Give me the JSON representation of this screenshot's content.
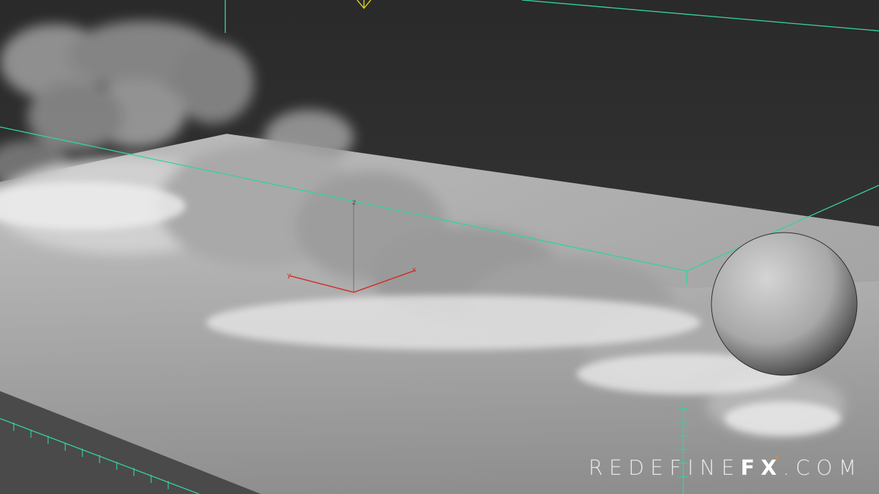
{
  "watermark": {
    "part1": "REDEFINE",
    "part2": "FX",
    "part3": ".COM"
  },
  "gizmo": {
    "x_label": "x",
    "y_label": "y",
    "z_label": "z"
  },
  "colors": {
    "background": "#2e2e2e",
    "container_box": "#35d29a",
    "axis_x": "#d0302a",
    "watermark_accent": "#e08a2c",
    "camera_marker": "#d8d020"
  }
}
